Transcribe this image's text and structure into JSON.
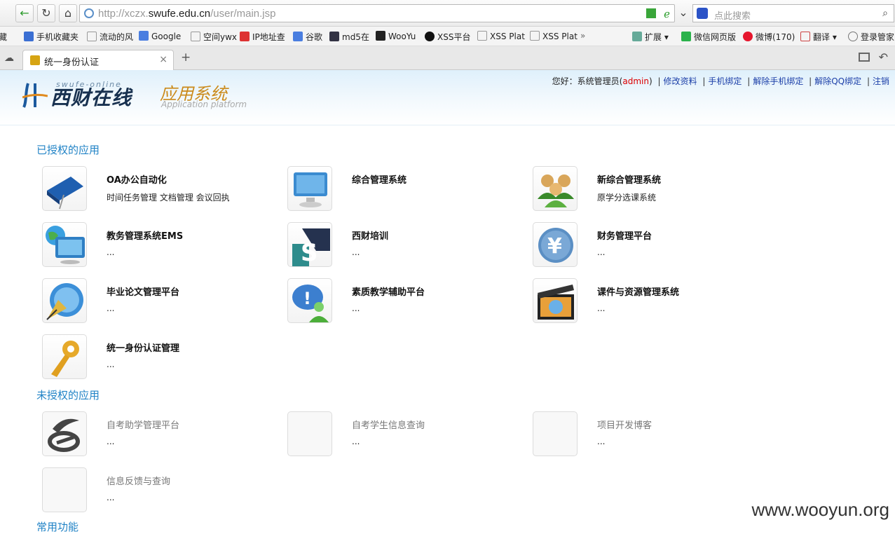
{
  "browser": {
    "url_prefix": "http://xczx.",
    "url_domain": "swufe.edu.cn",
    "url_path": "/user/main.jsp",
    "search_placeholder": "点此搜索",
    "bookmarks": [
      "藏",
      "手机收藏夹",
      "流动的风",
      "Google",
      "空间ywx",
      "IP地址查",
      "谷歌",
      "md5在",
      "WooYu",
      "XSS平台",
      "XSS Plat",
      "XSS Plat",
      "扩展",
      "微信网页版",
      "微博(170)",
      "翻译",
      "登录管家"
    ],
    "tab_title": "统一身份认证",
    "tab_close": "×",
    "new_tab": "+"
  },
  "header": {
    "logo_cn": "西财在线",
    "logo_en": "swufe-online",
    "app_cn": "应用系统",
    "app_en": "Application platform",
    "greeting": "您好：系统管理员(",
    "username": "admin",
    "greeting_end": ")",
    "links": [
      "修改资料",
      "手机绑定",
      "解除手机绑定",
      "解除QQ绑定",
      "注销"
    ]
  },
  "authorized": {
    "title": "已授权的应用",
    "apps": [
      {
        "name": "OA办公自动化",
        "desc": "时间任务管理 文档管理 会议回执",
        "icon": "book-icon"
      },
      {
        "name": "综合管理系统",
        "desc": "",
        "icon": "monitor-icon"
      },
      {
        "name": "新综合管理系统",
        "desc": "原学分选课系统",
        "icon": "users-icon"
      },
      {
        "name": "教务管理系统EMS",
        "desc": "...",
        "icon": "globe-monitor-icon"
      },
      {
        "name": "西财培训",
        "desc": "...",
        "icon": "s-logo-icon"
      },
      {
        "name": "财务管理平台",
        "desc": "...",
        "icon": "yen-icon"
      },
      {
        "name": "毕业论文管理平台",
        "desc": "...",
        "icon": "pen-globe-icon"
      },
      {
        "name": "素质教学辅助平台",
        "desc": "...",
        "icon": "chat-user-icon"
      },
      {
        "name": "课件与资源管理系统",
        "desc": "...",
        "icon": "clapper-icon"
      },
      {
        "name": "统一身份认证管理",
        "desc": "...",
        "icon": "key-icon"
      }
    ]
  },
  "unauthorized": {
    "title": "未授权的应用",
    "apps": [
      {
        "name": "自考助学管理平台",
        "desc": "...",
        "icon": "self-study-logo-icon"
      },
      {
        "name": "自考学生信息查询",
        "desc": "...",
        "icon": "blank-icon"
      },
      {
        "name": "项目开发博客",
        "desc": "...",
        "icon": "blank-icon"
      },
      {
        "name": "信息反馈与查询",
        "desc": "...",
        "icon": "blank-icon"
      }
    ]
  },
  "common": {
    "title": "常用功能"
  },
  "watermark": "www.wooyun.org"
}
